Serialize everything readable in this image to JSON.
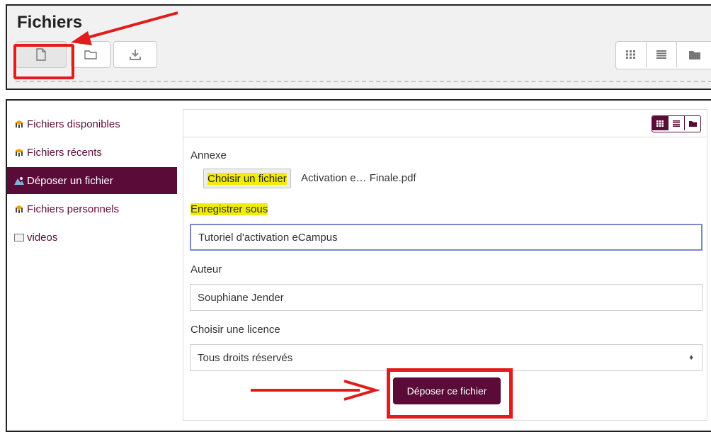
{
  "header": {
    "title": "Fichiers"
  },
  "icons": {
    "file": "file-icon",
    "folder": "folder-icon",
    "download": "download-icon",
    "grid": "grid-view-icon",
    "list": "list-view-icon",
    "tree": "folder-view-icon",
    "repo": "repository-icon",
    "upload": "upload-icon",
    "video": "video-icon"
  },
  "colors": {
    "accent": "#5a0b38",
    "highlight": "#f2ec0a",
    "annotation": "#e21b1b"
  },
  "sidebar": {
    "items": [
      {
        "label": "Fichiers disponibles"
      },
      {
        "label": "Fichiers récents"
      },
      {
        "label": "Déposer un fichier"
      },
      {
        "label": "Fichiers personnels"
      },
      {
        "label": "videos"
      }
    ]
  },
  "form": {
    "attachment_label": "Annexe",
    "choose_button": "Choisir un fichier",
    "chosen_file": "Activation e… Finale.pdf",
    "save_as_label": "Enregistrer sous",
    "save_as_value": "Tutoriel d'activation eCampus",
    "author_label": "Auteur",
    "author_value": "Souphiane Jender",
    "license_label": "Choisir une licence",
    "license_value": "Tous droits réservés",
    "submit_label": "Déposer ce fichier"
  }
}
